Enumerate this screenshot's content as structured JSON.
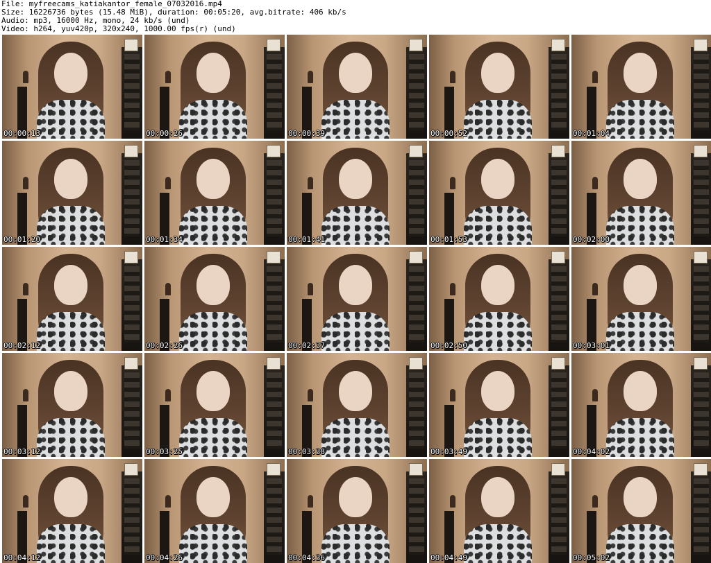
{
  "header": {
    "file_line": "File: myfreecams_katiakantor_female_07032016.mp4",
    "size_line": "Size: 16226736 bytes (15.48 MiB), duration: 00:05:20, avg.bitrate: 406 kb/s",
    "audio_line": "Audio: mp3, 16000 Hz, mono, 24 kb/s (und)",
    "video_line": "Video: h264, yuv420p, 320x240, 1000.00 fps(r) (und)"
  },
  "thumbnails": [
    {
      "timestamp": "00:00:13"
    },
    {
      "timestamp": "00:00:26"
    },
    {
      "timestamp": "00:00:39"
    },
    {
      "timestamp": "00:00:52"
    },
    {
      "timestamp": "00:01:04"
    },
    {
      "timestamp": "00:01:20"
    },
    {
      "timestamp": "00:01:34"
    },
    {
      "timestamp": "00:01:41"
    },
    {
      "timestamp": "00:01:53"
    },
    {
      "timestamp": "00:02:00"
    },
    {
      "timestamp": "00:02:12"
    },
    {
      "timestamp": "00:02:26"
    },
    {
      "timestamp": "00:02:37"
    },
    {
      "timestamp": "00:02:50"
    },
    {
      "timestamp": "00:03:01"
    },
    {
      "timestamp": "00:03:12"
    },
    {
      "timestamp": "00:03:25"
    },
    {
      "timestamp": "00:03:38"
    },
    {
      "timestamp": "00:03:49"
    },
    {
      "timestamp": "00:04:02"
    },
    {
      "timestamp": "00:04:12"
    },
    {
      "timestamp": "00:04:26"
    },
    {
      "timestamp": "00:04:36"
    },
    {
      "timestamp": "00:04:49"
    },
    {
      "timestamp": "00:05:02"
    }
  ]
}
